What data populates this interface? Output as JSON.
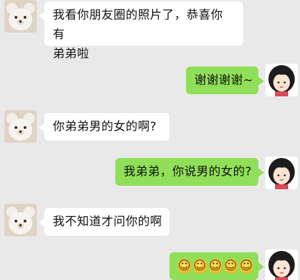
{
  "chat": {
    "messages": [
      {
        "side": "left",
        "lines": [
          "我看你朋友圈的照片了，恭喜你有",
          "弟弟啦"
        ]
      },
      {
        "side": "right",
        "text": "谢谢谢谢~"
      },
      {
        "side": "left",
        "text": "你弟弟男的女的啊?"
      },
      {
        "side": "right",
        "text": "我弟弟，你说男的女的?"
      },
      {
        "side": "left",
        "text": "我不知道才问你的啊"
      },
      {
        "side": "right",
        "emoji": [
          "☺",
          "☺",
          "☺",
          "☺",
          "☺"
        ]
      }
    ]
  },
  "avatars": {
    "friend": "teddy-bear",
    "self": "cartoon-girl"
  },
  "colors": {
    "background": "#e9e9e9",
    "incoming_bubble": "#ffffff",
    "outgoing_bubble": "#8fdf58"
  }
}
